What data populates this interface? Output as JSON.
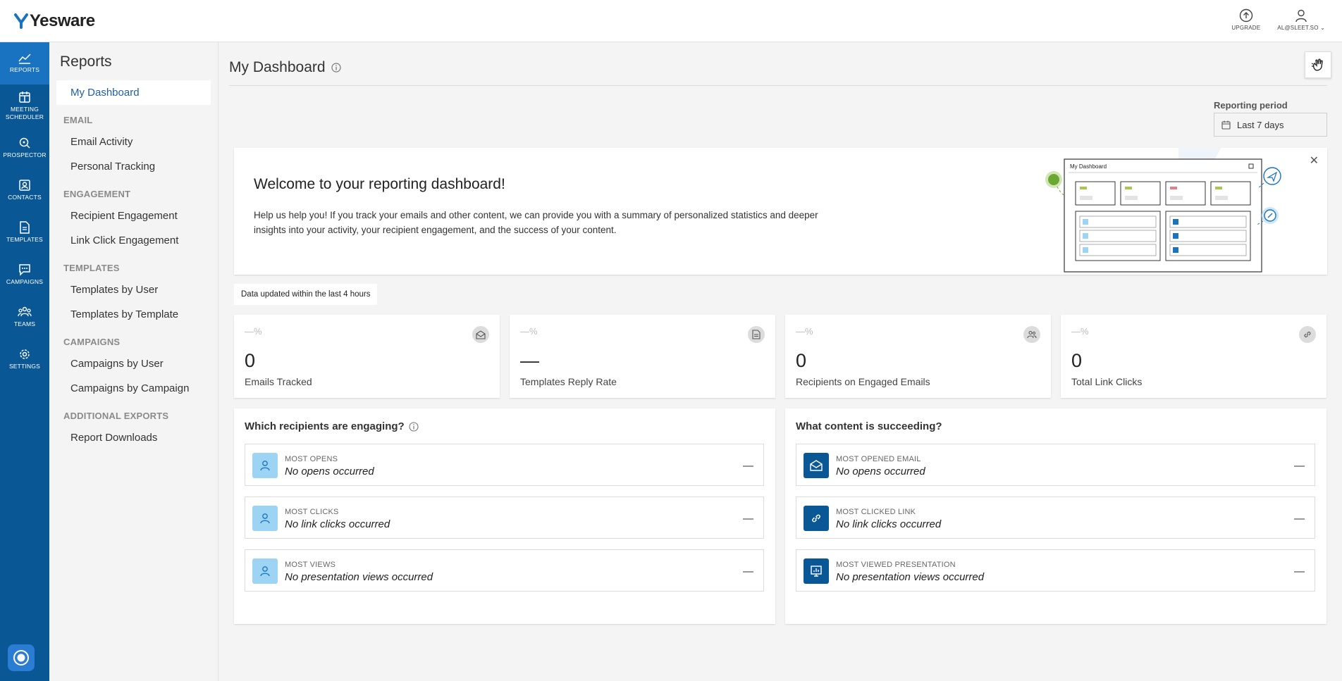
{
  "app": {
    "logo_text": "Yesware"
  },
  "top_actions": [
    {
      "label": "UPGRADE",
      "icon": "upgrade-arrow-icon"
    },
    {
      "label": "AL@SLEET.SO",
      "icon": "user-icon"
    }
  ],
  "rail": [
    {
      "label": "REPORTS",
      "icon": "chart-line-icon",
      "active": true
    },
    {
      "label": "MEETING SCHEDULER",
      "icon": "calendar-icon",
      "active": false
    },
    {
      "label": "PROSPECTOR",
      "icon": "magnifier-icon",
      "active": false
    },
    {
      "label": "CONTACTS",
      "icon": "contact-card-icon",
      "active": false
    },
    {
      "label": "TEMPLATES",
      "icon": "document-icon",
      "active": false
    },
    {
      "label": "CAMPAIGNS",
      "icon": "chat-icon",
      "active": false
    },
    {
      "label": "TEAMS",
      "icon": "team-icon",
      "active": false
    },
    {
      "label": "SETTINGS",
      "icon": "gear-icon",
      "active": false
    }
  ],
  "sidebar": {
    "title": "Reports",
    "my_dashboard": "My Dashboard",
    "sections": [
      {
        "heading": "EMAIL",
        "items": [
          "Email Activity",
          "Personal Tracking"
        ]
      },
      {
        "heading": "ENGAGEMENT",
        "items": [
          "Recipient Engagement",
          "Link Click Engagement"
        ]
      },
      {
        "heading": "TEMPLATES",
        "items": [
          "Templates by User",
          "Templates by Template"
        ]
      },
      {
        "heading": "CAMPAIGNS",
        "items": [
          "Campaigns by User",
          "Campaigns by Campaign"
        ]
      },
      {
        "heading": "ADDITIONAL EXPORTS",
        "items": [
          "Report Downloads"
        ]
      }
    ]
  },
  "main": {
    "title": "My Dashboard",
    "reporting_period_label": "Reporting period",
    "reporting_period_value": "Last 7 days",
    "welcome": {
      "heading": "Welcome to your reporting dashboard!",
      "body": "Help us help you! If you track your emails and other content, we can provide you with a summary of personalized statistics and deeper insights into your activity, your recipient engagement, and the success of your content.",
      "illustration_title": "My Dashboard"
    },
    "updated_note": "Data updated within the last 4 hours",
    "stats": [
      {
        "pct": "—%",
        "value": "0",
        "label": "Emails Tracked",
        "icon": "envelope-open-icon"
      },
      {
        "pct": "—%",
        "value": "—",
        "label": "Templates Reply Rate",
        "icon": "document-icon"
      },
      {
        "pct": "—%",
        "value": "0",
        "label": "Recipients on Engaged Emails",
        "icon": "people-icon"
      },
      {
        "pct": "—%",
        "value": "0",
        "label": "Total Link Clicks",
        "icon": "link-icon"
      }
    ],
    "recipients_panel": {
      "title": "Which recipients are engaging?",
      "rows": [
        {
          "label": "MOST OPENS",
          "value": "No opens occurred",
          "trail": "—"
        },
        {
          "label": "MOST CLICKS",
          "value": "No link clicks occurred",
          "trail": "—"
        },
        {
          "label": "MOST VIEWS",
          "value": "No presentation views occurred",
          "trail": "—"
        }
      ]
    },
    "content_panel": {
      "title": "What content is succeeding?",
      "rows": [
        {
          "label": "MOST OPENED EMAIL",
          "value": "No opens occurred",
          "trail": "—",
          "icon": "envelope-open-icon"
        },
        {
          "label": "MOST CLICKED LINK",
          "value": "No link clicks occurred",
          "trail": "—",
          "icon": "link-icon"
        },
        {
          "label": "MOST VIEWED PRESENTATION",
          "value": "No presentation views occurred",
          "trail": "—",
          "icon": "presentation-icon"
        }
      ]
    }
  },
  "colors": {
    "rail": "#0a5796",
    "rail_active": "#1a73c0",
    "accent": "#1f5fa0",
    "avatar_light": "#9ed4f3"
  }
}
